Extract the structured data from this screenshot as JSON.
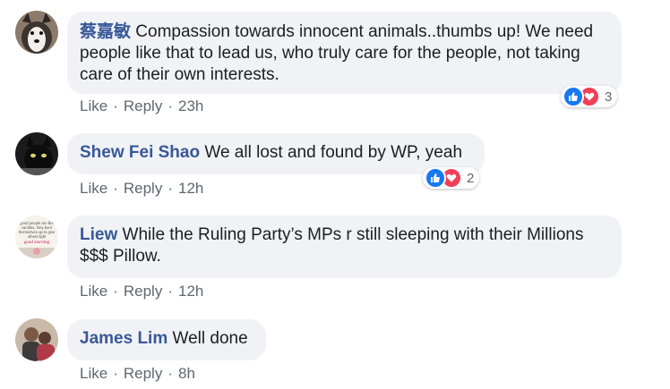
{
  "comments": [
    {
      "author": "蔡嘉敏",
      "text": "Compassion towards innocent animals..thumbs up! We need people like that to lead us, who truly care for the people, not taking care of their own interests.",
      "like": "Like",
      "reply": "Reply",
      "time": "23h",
      "reaction_count": "3",
      "avatar": "dog-photo"
    },
    {
      "author": "Shew Fei Shao",
      "text": "We all lost and found by WP, yeah",
      "like": "Like",
      "reply": "Reply",
      "time": "12h",
      "reaction_count": "2",
      "avatar": "black-cat-photo"
    },
    {
      "author": "Liew",
      "text": "While the Ruling Party’s MPs r still sleeping with their Millions $$$ Pillow.",
      "like": "Like",
      "reply": "Reply",
      "time": "12h",
      "avatar": "text-card-photo",
      "avatar_text": [
        "good people are like",
        "candles, they burn",
        "themselves up to give",
        "others light",
        "good morning"
      ]
    },
    {
      "author": "James Lim",
      "text": "Well done",
      "like": "Like",
      "reply": "Reply",
      "time": "8h",
      "avatar": "people-photo"
    }
  ],
  "colors": {
    "author": "#385898",
    "bubble": "#f0f2f5",
    "meta": "#606770",
    "like": "#1877f2",
    "love": "#f33e58"
  }
}
